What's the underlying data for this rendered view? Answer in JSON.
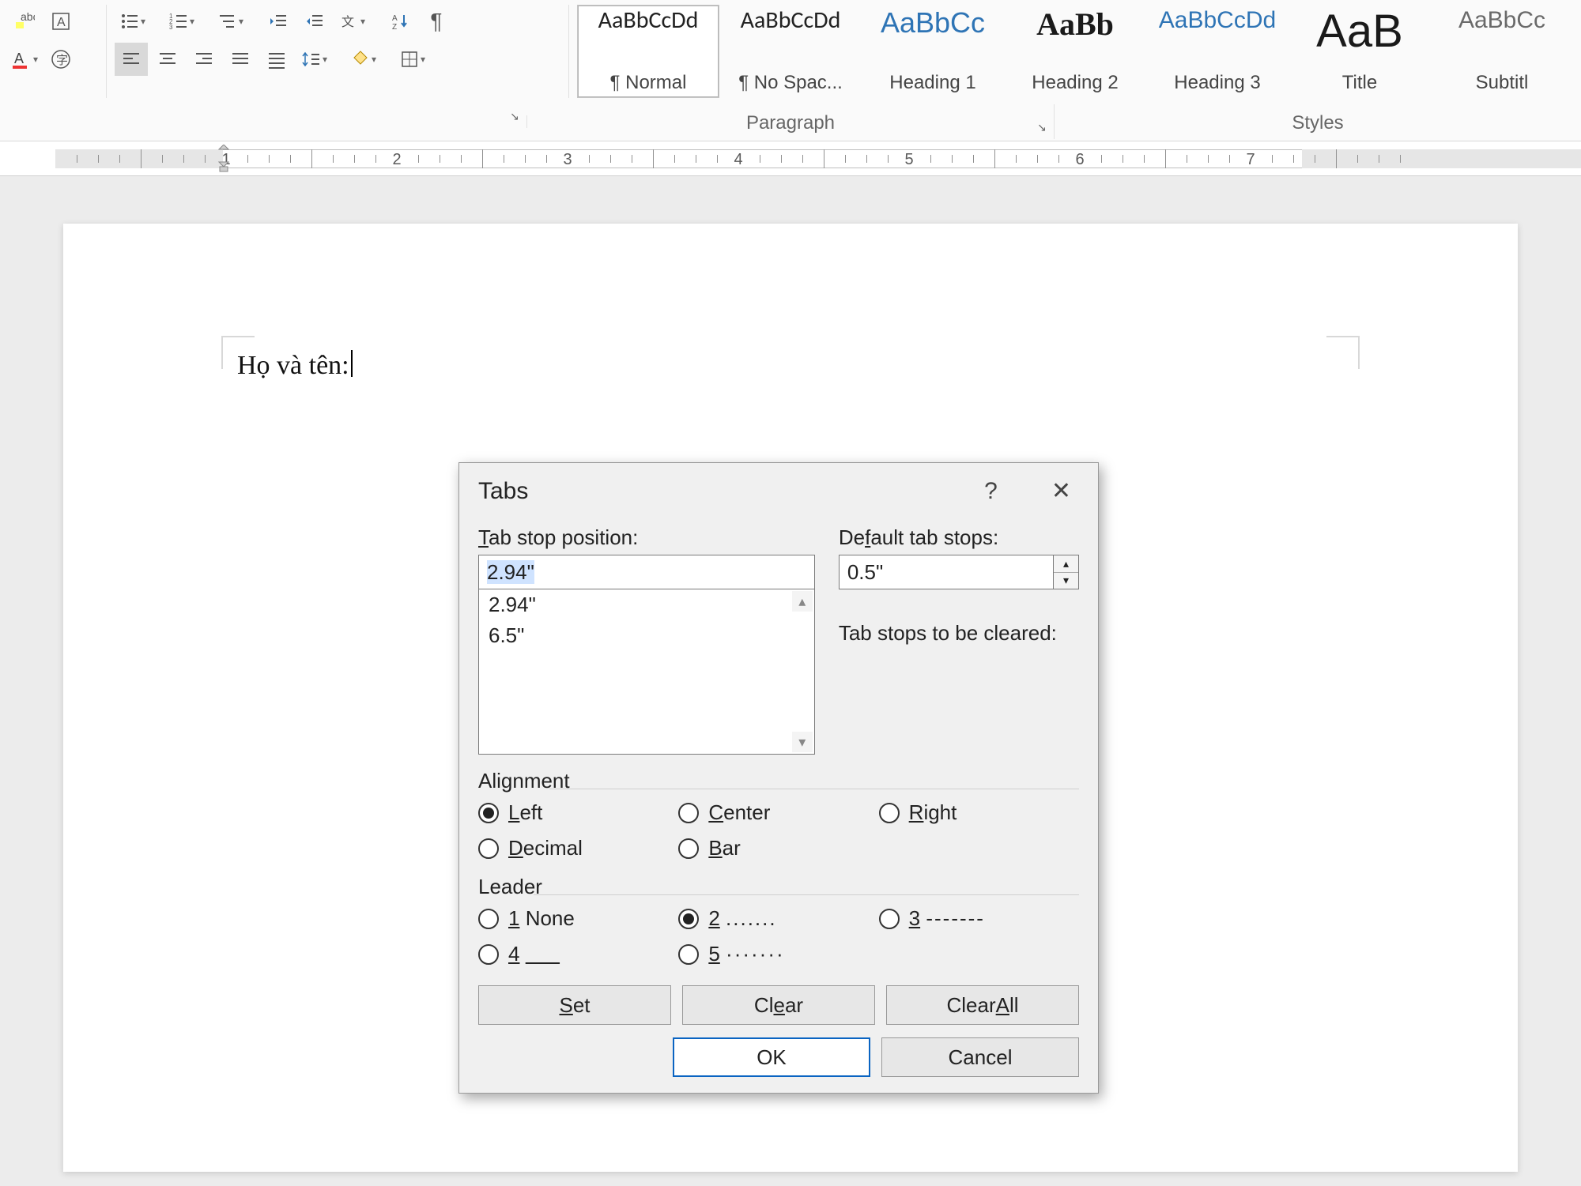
{
  "ribbon": {
    "paragraph_label": "Paragraph",
    "styles_label": "Styles"
  },
  "styles": [
    {
      "preview": "AaBbCcDd",
      "name": "¶ Normal",
      "color": "#222",
      "font": "Calibri, sans-serif",
      "size": "30px",
      "selected": true
    },
    {
      "preview": "AaBbCcDd",
      "name": "¶ No Spac...",
      "color": "#222",
      "font": "Calibri, sans-serif",
      "size": "30px"
    },
    {
      "preview": "AaBbCc",
      "name": "Heading 1",
      "color": "#2e74b5",
      "font": "Calibri Light, sans-serif",
      "size": "36px"
    },
    {
      "preview": "AaBb",
      "name": "Heading 2",
      "color": "#1a1a1a",
      "font": "\"Times New Roman\", serif",
      "size": "40px",
      "weight": "bold"
    },
    {
      "preview": "AaBbCcDd",
      "name": "Heading 3",
      "color": "#2e74b5",
      "font": "Calibri Light, sans-serif",
      "size": "30px"
    },
    {
      "preview": "AaB",
      "name": "Title",
      "color": "#1a1a1a",
      "font": "Calibri Light, sans-serif",
      "size": "58px"
    },
    {
      "preview": "AaBbCc",
      "name": "Subtitl",
      "color": "#6a6a6a",
      "font": "Calibri Light, sans-serif",
      "size": "30px"
    }
  ],
  "ruler": {
    "numbers": [
      "1",
      "2",
      "3",
      "4",
      "5",
      "6",
      "7"
    ]
  },
  "document": {
    "line1": "Họ và tên:"
  },
  "dialog": {
    "title": "Tabs",
    "labels": {
      "tab_stop_position": "Tab stop position:",
      "default_tab_stops": "Default tab stops:",
      "tab_stops_to_be_cleared": "Tab stops to be cleared:",
      "alignment": "Alignment",
      "leader": "Leader"
    },
    "tab_stop_value": "2.94\"",
    "tab_stop_list": [
      "2.94\"",
      "6.5\""
    ],
    "default_tab_stop": "0.5\"",
    "alignment": {
      "left": "Left",
      "center": "Center",
      "right": "Right",
      "decimal": "Decimal",
      "bar": "Bar",
      "selected": "left"
    },
    "leader": {
      "opt1": "1 None",
      "opt2": "2 .......",
      "opt3": "3 -------",
      "opt4": "4 ___",
      "opt5": "5 ·······",
      "selected": "2"
    },
    "buttons": {
      "set": "Set",
      "clear": "Clear",
      "clear_all": "Clear All",
      "ok": "OK",
      "cancel": "Cancel"
    }
  }
}
